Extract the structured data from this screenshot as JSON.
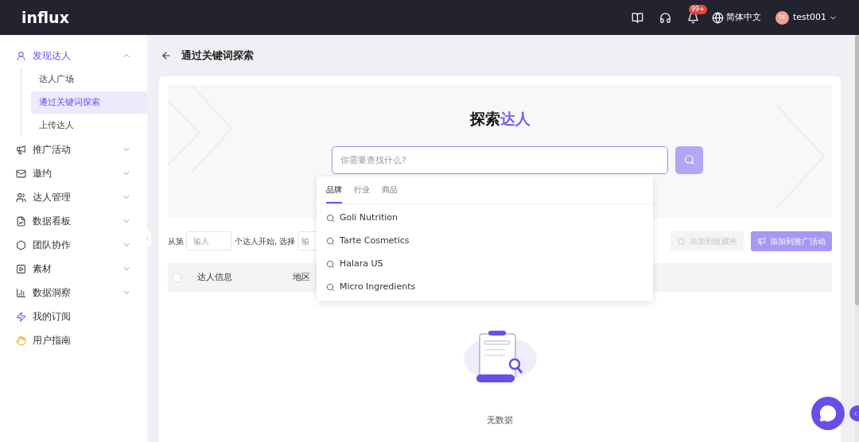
{
  "header": {
    "logo": "influx",
    "notifications_badge": "99+",
    "language": "简体中文",
    "avatar_initials": "TE",
    "username": "test001"
  },
  "sidebar": {
    "items": [
      {
        "label": "发现达人",
        "kind": "group",
        "expanded": true,
        "children": [
          {
            "label": "达人广场",
            "selected": false
          },
          {
            "label": "通过关键词探索",
            "selected": true
          },
          {
            "label": "上传达人",
            "selected": false
          }
        ]
      },
      {
        "label": "推广活动",
        "kind": "group",
        "expanded": false
      },
      {
        "label": "邀约",
        "kind": "group",
        "expanded": false
      },
      {
        "label": "达人管理",
        "kind": "group",
        "expanded": false
      },
      {
        "label": "数据看板",
        "kind": "group",
        "expanded": false
      },
      {
        "label": "团队协作",
        "kind": "group",
        "expanded": false
      },
      {
        "label": "素材",
        "kind": "group",
        "expanded": false
      },
      {
        "label": "数据洞察",
        "kind": "group",
        "expanded": false
      },
      {
        "label": "我的订阅",
        "kind": "link"
      },
      {
        "label": "用户指南",
        "kind": "link"
      }
    ]
  },
  "page": {
    "title": "通过关键词探索"
  },
  "hero": {
    "title": "探索",
    "title_highlight": "达人",
    "search": {
      "placeholder": "你需要查找什么?"
    }
  },
  "dropdown": {
    "tabs": [
      {
        "label": "品牌",
        "selected": true
      },
      {
        "label": "行业",
        "selected": false
      },
      {
        "label": "商品",
        "selected": false
      }
    ],
    "items": [
      "Goli Nutrition",
      "Tarte Cosmetics",
      "Halara US",
      "Micro Ingredients"
    ]
  },
  "toolbar": {
    "prefix": "从第",
    "start_placeholder": "输入",
    "middle": "个达人开始, 选择",
    "count_placeholder": "输",
    "buttons": [
      {
        "label": "添加到收藏夹",
        "kind": "favorite",
        "disabled": true
      },
      {
        "label": "添加到推广活动",
        "kind": "campaign",
        "disabled": true
      }
    ]
  },
  "table": {
    "select_all_checked": false,
    "columns": [
      "达人信息",
      "地区"
    ],
    "empty_text": "无数据"
  }
}
